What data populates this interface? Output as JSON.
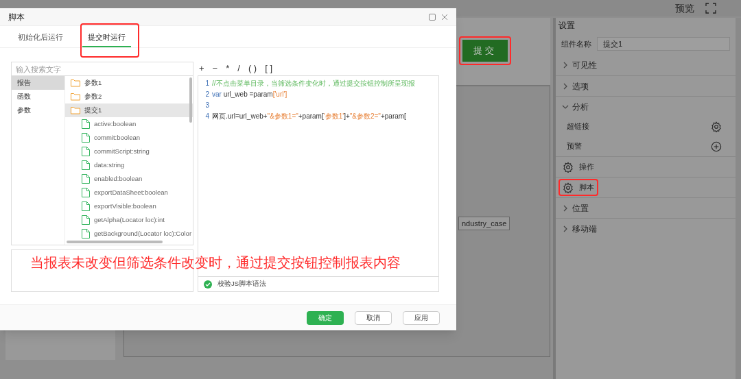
{
  "topbar": {
    "preview": "预览"
  },
  "canvas": {
    "submit_button": "提交",
    "highlighted": true,
    "label": "ndustry_case"
  },
  "settings": {
    "title": "设置",
    "name_label": "组件名称",
    "name_value": "提交1",
    "items": [
      {
        "kind": "section",
        "label": "可见性",
        "expanded": false
      },
      {
        "kind": "section",
        "label": "选项",
        "expanded": false
      },
      {
        "kind": "section",
        "label": "分析",
        "expanded": true
      },
      {
        "kind": "setting",
        "label": "超链接"
      },
      {
        "kind": "adder",
        "label": "预警"
      },
      {
        "kind": "action",
        "label": "操作",
        "highlighted": false
      },
      {
        "kind": "action",
        "label": "脚本",
        "highlighted": true
      },
      {
        "kind": "section",
        "label": "位置",
        "expanded": false
      },
      {
        "kind": "section",
        "label": "移动端",
        "expanded": false
      }
    ]
  },
  "dialog": {
    "title": "脚本",
    "tabs": [
      {
        "label": "初始化后运行",
        "selected": false
      },
      {
        "label": "提交时运行",
        "selected": true,
        "highlighted": true
      }
    ],
    "search": {
      "placeholder": "输入搜索文字"
    },
    "categories": [
      {
        "label": "报告",
        "selected": true
      },
      {
        "label": "函数",
        "selected": false
      },
      {
        "label": "参数",
        "selected": false
      }
    ],
    "tree": [
      {
        "kind": "folder",
        "label": "参数1",
        "selected": false
      },
      {
        "kind": "folder",
        "label": "参数2",
        "selected": false
      },
      {
        "kind": "folder",
        "label": "提交1",
        "selected": true,
        "children": [
          {
            "kind": "file",
            "label": "active:boolean",
            "selected": false
          },
          {
            "kind": "file",
            "label": "commit:boolean",
            "selected": false
          },
          {
            "kind": "file",
            "label": "commitScript:string",
            "selected": false
          },
          {
            "kind": "file",
            "label": "data:string",
            "selected": false
          },
          {
            "kind": "file",
            "label": "enabled:boolean",
            "selected": false
          },
          {
            "kind": "file",
            "label": "exportDataSheet:boolean",
            "selected": false
          },
          {
            "kind": "file",
            "label": "exportVisible:boolean",
            "selected": false
          },
          {
            "kind": "file",
            "label": "getAlpha(Locator loc):int",
            "selected": false
          },
          {
            "kind": "file",
            "label": "getBackground(Locator loc):Color",
            "selected": false
          }
        ]
      }
    ],
    "operators": [
      "+",
      "−",
      "*",
      "/",
      "( )",
      "[ ]"
    ],
    "code": [
      {
        "number": "1",
        "tokens": [
          {
            "kind": "comment",
            "text": "//不点击菜单目录，当筛选条件变化时，通过提交按钮控制所呈现报"
          }
        ]
      },
      {
        "number": "2",
        "tokens": [
          {
            "kind": "keyword",
            "text": "var"
          },
          {
            "kind": "plain",
            "text": " url_web =param"
          },
          {
            "kind": "string",
            "text": "['url']"
          }
        ]
      },
      {
        "number": "3"
      },
      {
        "number": "4",
        "tokens": [
          {
            "kind": "plain",
            "text": "网页.url=url_web+"
          },
          {
            "kind": "string",
            "text": "\"&参数1=\""
          },
          {
            "kind": "plain",
            "text": "+param["
          },
          {
            "kind": "string",
            "text": "'参数1'"
          },
          {
            "kind": "plain",
            "text": "]+"
          },
          {
            "kind": "string",
            "text": "\"&参数2=\""
          },
          {
            "kind": "plain",
            "text": "+param["
          }
        ]
      }
    ],
    "validate": "校验JS脚本语法",
    "annotation": "当报表未改变但筛选条件改变时，通过提交按钮控制报表内容",
    "buttons": [
      {
        "label": "确定",
        "primary": true
      },
      {
        "label": "取消",
        "primary": false
      },
      {
        "label": "应用",
        "primary": false
      }
    ]
  }
}
